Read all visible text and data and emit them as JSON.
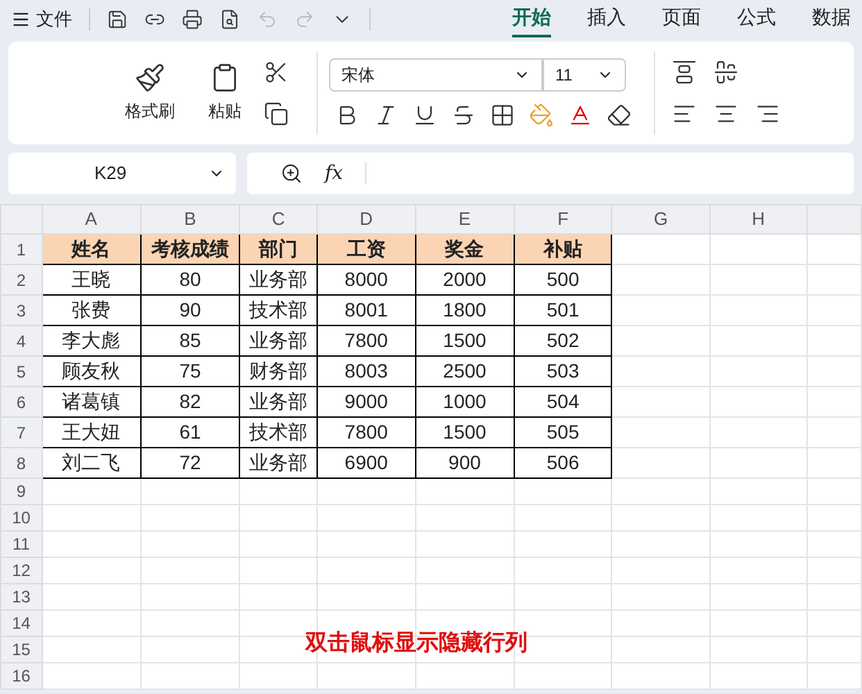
{
  "menu": {
    "label": "文件"
  },
  "tabs": [
    {
      "label": "开始",
      "selected": true
    },
    {
      "label": "插入",
      "selected": false
    },
    {
      "label": "页面",
      "selected": false
    },
    {
      "label": "公式",
      "selected": false
    },
    {
      "label": "数据",
      "selected": false
    }
  ],
  "ribbon": {
    "format_painter": "格式刷",
    "paste": "粘贴",
    "font": "宋体",
    "font_size": "11"
  },
  "formula_bar": {
    "name_box": "K29",
    "fx": "fx"
  },
  "sheet": {
    "column_headers": [
      "A",
      "B",
      "C",
      "D",
      "E",
      "F",
      "G",
      "H"
    ],
    "row_numbers": [
      "1",
      "2",
      "3",
      "4",
      "5",
      "6",
      "7",
      "8",
      "9",
      "10",
      "11",
      "12",
      "13",
      "14",
      "15",
      "16"
    ],
    "header": [
      "姓名",
      "考核成绩",
      "部门",
      "工资",
      "奖金",
      "补贴"
    ],
    "rows": [
      [
        "王晓",
        "80",
        "业务部",
        "8000",
        "2000",
        "500"
      ],
      [
        "张费",
        "90",
        "技术部",
        "8001",
        "1800",
        "501"
      ],
      [
        "李大彪",
        "85",
        "业务部",
        "7800",
        "1500",
        "502"
      ],
      [
        "顾友秋",
        "75",
        "财务部",
        "8003",
        "2500",
        "503"
      ],
      [
        "诸葛镇",
        "82",
        "业务部",
        "9000",
        "1000",
        "504"
      ],
      [
        "王大妞",
        "61",
        "技术部",
        "7800",
        "1500",
        "505"
      ],
      [
        "刘二飞",
        "72",
        "业务部",
        "6900",
        "900",
        "506"
      ]
    ]
  },
  "caption": "双击鼠标显示隐藏行列"
}
